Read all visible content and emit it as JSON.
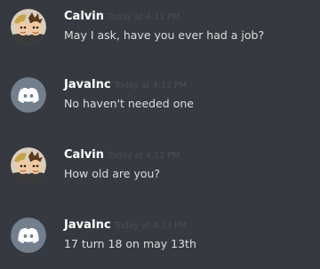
{
  "messages": [
    {
      "author": "Calvin",
      "avatar": "cartoon-avatar",
      "timestamp": "Today at 4:11 PM",
      "text": "May I ask, have you ever had a job?"
    },
    {
      "author": "JavaInc",
      "avatar": "discord-default-avatar",
      "timestamp": "Today at 4:12 PM",
      "text": "No haven't needed one"
    },
    {
      "author": "Calvin",
      "avatar": "cartoon-avatar",
      "timestamp": "Today at 4:12 PM",
      "text": "How old are you?"
    },
    {
      "author": "JavaInc",
      "avatar": "discord-default-avatar",
      "timestamp": "Today at 4:13 PM",
      "text": "17 turn 18 on may 13th"
    }
  ],
  "colors": {
    "background": "#36393f",
    "author": "#ffffff",
    "timestamp": "#4b4e54",
    "message_text": "#dcddde",
    "default_avatar_bg": "#737f8d"
  }
}
